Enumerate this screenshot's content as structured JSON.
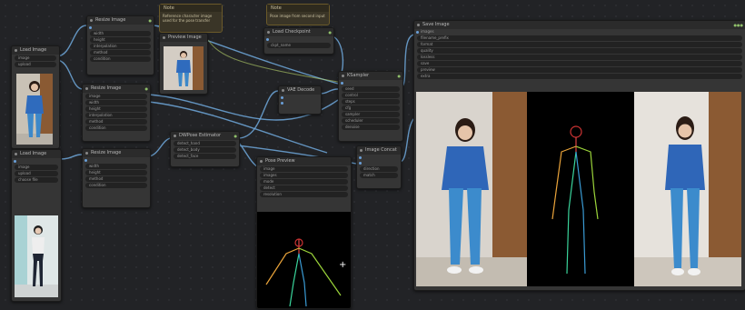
{
  "canvas": {
    "name": "workflow-canvas"
  },
  "nodes": {
    "load_image_1": {
      "title": "Load Image",
      "rows": [
        "image",
        "upload"
      ]
    },
    "resize_1": {
      "title": "Resize Image",
      "rows": [
        "width",
        "height",
        "interpolation",
        "method",
        "condition"
      ]
    },
    "note_1": {
      "title": "Note",
      "text": "Reference character image used for the pose transfer"
    },
    "note_2": {
      "title": "Note",
      "text": "Pose image from second input"
    },
    "preview_1": {
      "title": "Preview Image"
    },
    "resize_2": {
      "title": "Resize Image",
      "rows": [
        "image",
        "width",
        "height",
        "interpolation",
        "method",
        "condition"
      ]
    },
    "load_image_2": {
      "title": "Load Image",
      "rows": [
        "image",
        "upload",
        "choose file"
      ]
    },
    "resize_3": {
      "title": "Resize Image",
      "rows": [
        "width",
        "height",
        "method",
        "condition"
      ]
    },
    "dwpose": {
      "title": "DWPose Estimator",
      "rows": [
        "detect_hand",
        "detect_body",
        "detect_face",
        "resolution"
      ]
    },
    "load_model": {
      "title": "Load Checkpoint",
      "rows": [
        "ckpt_name"
      ]
    },
    "vae_decode": {
      "title": "VAE Decode"
    },
    "sampler": {
      "title": "KSampler",
      "rows": [
        "seed",
        "control",
        "steps",
        "cfg",
        "sampler",
        "scheduler",
        "denoise"
      ]
    },
    "cond": {
      "title": "Image Concat",
      "rows": [
        "direction",
        "match"
      ]
    },
    "pose_preview": {
      "title": "Pose Preview",
      "rows": [
        "image",
        "images",
        "mode",
        "detect",
        "resolution"
      ]
    },
    "output": {
      "title": "Save Image",
      "rows": [
        "images",
        "filename_prefix",
        "format",
        "quality",
        "lossless",
        "save",
        "preview",
        "extra"
      ]
    }
  }
}
